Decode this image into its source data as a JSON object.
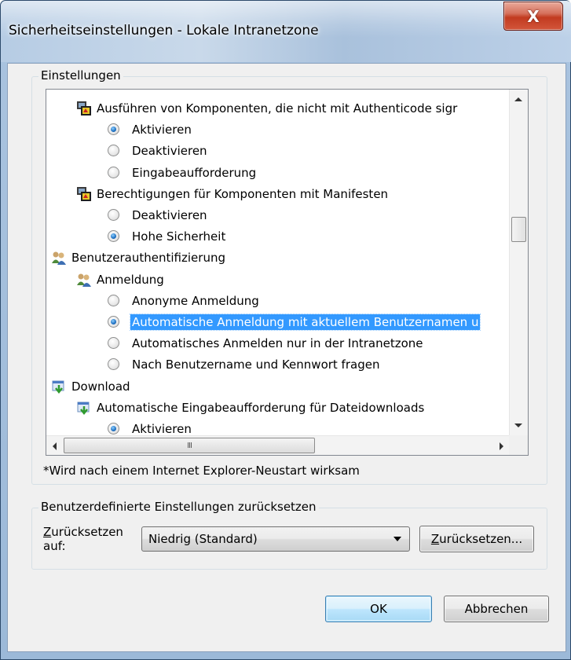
{
  "window": {
    "title": "Sicherheitseinstellungen - Lokale Intranetzone",
    "close_glyph": "X"
  },
  "settings": {
    "legend": "Einstellungen",
    "rows": [
      {
        "kind": "setting",
        "icon": "component-settings-icon",
        "label": "Ausführen von Komponenten, die nicht mit Authenticode sigr"
      },
      {
        "kind": "option",
        "checked": true,
        "label": "Aktivieren"
      },
      {
        "kind": "option",
        "checked": false,
        "label": "Deaktivieren"
      },
      {
        "kind": "option",
        "checked": false,
        "label": "Eingabeaufforderung"
      },
      {
        "kind": "setting",
        "icon": "component-settings-icon",
        "label": "Berechtigungen für Komponenten mit Manifesten"
      },
      {
        "kind": "option",
        "checked": false,
        "label": "Deaktivieren"
      },
      {
        "kind": "option",
        "checked": true,
        "label": "Hohe Sicherheit"
      },
      {
        "kind": "category",
        "icon": "users-icon",
        "label": "Benutzerauthentifizierung"
      },
      {
        "kind": "setting",
        "icon": "users-icon",
        "label": "Anmeldung"
      },
      {
        "kind": "option",
        "checked": false,
        "label": "Anonyme Anmeldung"
      },
      {
        "kind": "option",
        "checked": true,
        "selected": true,
        "label": "Automatische Anmeldung mit aktuellem Benutzernamen u"
      },
      {
        "kind": "option",
        "checked": false,
        "label": "Automatisches Anmelden nur in der Intranetzone"
      },
      {
        "kind": "option",
        "checked": false,
        "label": "Nach Benutzername und Kennwort fragen"
      },
      {
        "kind": "category",
        "icon": "download-icon",
        "label": "Download"
      },
      {
        "kind": "setting",
        "icon": "download-icon",
        "label": "Automatische Eingabeaufforderung für Dateidownloads"
      },
      {
        "kind": "option",
        "checked": true,
        "label": "Aktivieren"
      }
    ],
    "hscroll_grip": "III",
    "note": "*Wird nach einem Internet Explorer-Neustart wirksam"
  },
  "reset": {
    "legend": "Benutzerdefinierte Einstellungen zurücksetzen",
    "label_line1_acc": "Z",
    "label_line1_rest": "urücksetzen",
    "label_line2": "auf:",
    "select_value": "Niedrig (Standard)",
    "button_acc": "Z",
    "button_rest": "urücksetzen..."
  },
  "footer": {
    "ok_label": "OK",
    "cancel_label": "Abbrechen"
  }
}
